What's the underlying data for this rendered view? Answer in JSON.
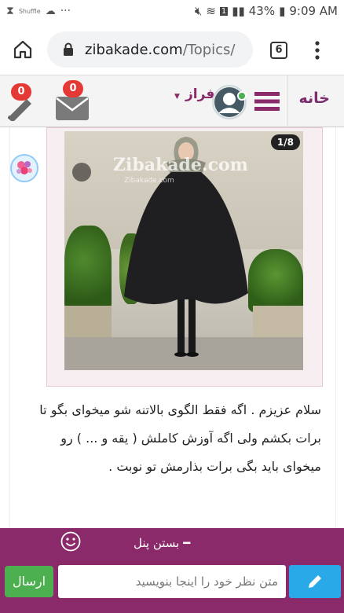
{
  "status_bar": {
    "left_label": "Shuffle",
    "battery": "43%",
    "time": "9:09 AM",
    "sim": "1"
  },
  "browser": {
    "url_domain": "zibakade.com",
    "url_path": "/Topics/",
    "tab_count": "6"
  },
  "site_header": {
    "home_label": "خانه",
    "user_label": "فراز",
    "messages_badge": "0",
    "notifications_badge": "0"
  },
  "post": {
    "image_counter": "1/8",
    "watermark": "Zibakade.com",
    "watermark_small": "Zibakade.com",
    "text": "سلام عزیزم . اگه فقط الگوی بالاتنه شو میخوای بگو تا برات بکشم ولی اگه آوزش کاملش ( یقه و ... ) رو میخوای باید بگی برات بذارمش تو نوبت ."
  },
  "comment_panel": {
    "close_label": "بستن پنل",
    "input_placeholder": "متن نظر خود را اینجا بنویسید",
    "send_label": "ارسال"
  },
  "colors": {
    "brand_purple": "#8b2a6a",
    "badge_red": "#e53935",
    "send_green": "#4caf50",
    "edit_blue": "#29a9e8"
  }
}
